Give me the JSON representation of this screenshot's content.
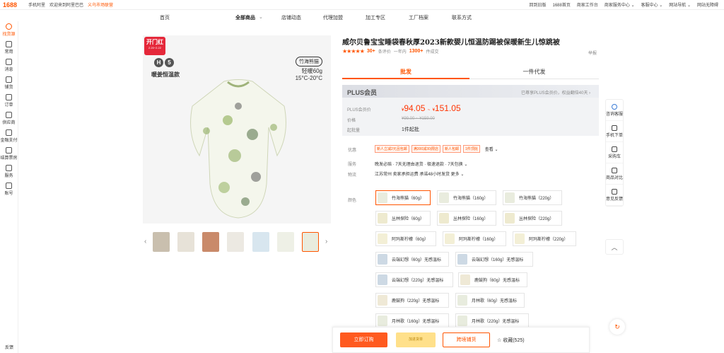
{
  "topbar": {
    "logo": "1688",
    "left": [
      "手机阿里",
      "欢迎来到阿里巴巴",
      "义乌市场联营"
    ],
    "right": [
      "回到旧版",
      "1688首页",
      "商家工作台",
      "商家服务中心 ⌄",
      "客服中心 ⌄",
      "网站导航 ⌄",
      "网站无障碍"
    ]
  },
  "sidebar": {
    "items": [
      "找货源",
      "常用",
      "消息",
      "铺货",
      "订单",
      "供应商",
      "金融支付",
      "结算票房",
      "服务",
      "账号"
    ],
    "bottom": "反馈"
  },
  "nav": {
    "home": "首页",
    "all": "全部商品",
    "shop": "店铺动态",
    "agent": "代理加盟",
    "process": "加工专区",
    "factory": "工厂档案",
    "contact": "联系方式"
  },
  "image": {
    "badge_title": "开门红",
    "badge_date": "2.20~2.22",
    "h5": [
      "H",
      "5"
    ],
    "warm": "暖姜恒温款",
    "panda": "竹海熊猫",
    "weight": "轻暖60g",
    "temp": "15°C-20°C"
  },
  "product": {
    "title": "威尔贝鲁宝宝睡袋春秋厚2023新款婴儿恒温防踢被保暖新生儿惊跳被",
    "stars": "★★★★★",
    "reviews_count": "30+",
    "reviews_label": "条评价",
    "period": "一年内",
    "sold": "1300+",
    "sold_label": "件成交",
    "report": "举报"
  },
  "tabs": {
    "wholesale": "批发",
    "dropship": "一件代发"
  },
  "price": {
    "plus_title": "PLUS会员",
    "plus_note": "已尊享PLUS会员价，权益翻倍40天 ›",
    "plus_label": "PLUS会员价",
    "low": "94.05",
    "high": "151.05",
    "currency": "¥",
    "dash": "~",
    "orig_label": "价格",
    "orig": "¥99.00 ~ ¥159.00",
    "moq_label": "起批量",
    "moq": "1件起批"
  },
  "info": {
    "discount_label": "优惠",
    "coupons": [
      "新人立减2元且包邮",
      "满300减30|限店",
      "新人包邮",
      "1件顶批"
    ],
    "more": "查看 ⌄",
    "service_label": "服务",
    "service": "晚发必赔 · 7天无理由退货 · 极速退款 · 7天包换 ⌄",
    "logistics_label": "物流",
    "logistics": "江苏常州   卖家承担运费   承诺48小时发货  更多 ⌄"
  },
  "colors": {
    "label": "颜色",
    "options": [
      "竹海熊猫（60g）",
      "竹海熊猫（160g）",
      "竹海熊猫（220g）",
      "丛林探险（60g）",
      "丛林探险（160g）",
      "丛林探险（220g）",
      "阿玛斯柠檬（60g）",
      "阿玛斯柠檬（160g）",
      "阿玛斯柠檬（220g）",
      "云端幻想（60g）无感温标",
      "云端幻想（160g）无感温标",
      "云端幻想（220g）无感温标",
      "鹿鼓狗（60g）无感温标",
      "鹿鼓狗（220g）无感温标",
      "月林歌（60g）无感温标",
      "月林歌（160g）无感温标",
      "月林歌（220g）无感温标"
    ]
  },
  "bottom": {
    "buy": "立即订购",
    "cart": "加进货单",
    "cross": "跨境铺货",
    "fav": "☆ 收藏(525)"
  },
  "rail": {
    "items": [
      "咨询客服",
      "手机下单",
      "采购车",
      "商品对比",
      "意见反馈"
    ],
    "top": "︿"
  },
  "colors_theme": {
    "accent": "#ff5500",
    "price": "#ff3300",
    "badge": "#e5283a"
  }
}
